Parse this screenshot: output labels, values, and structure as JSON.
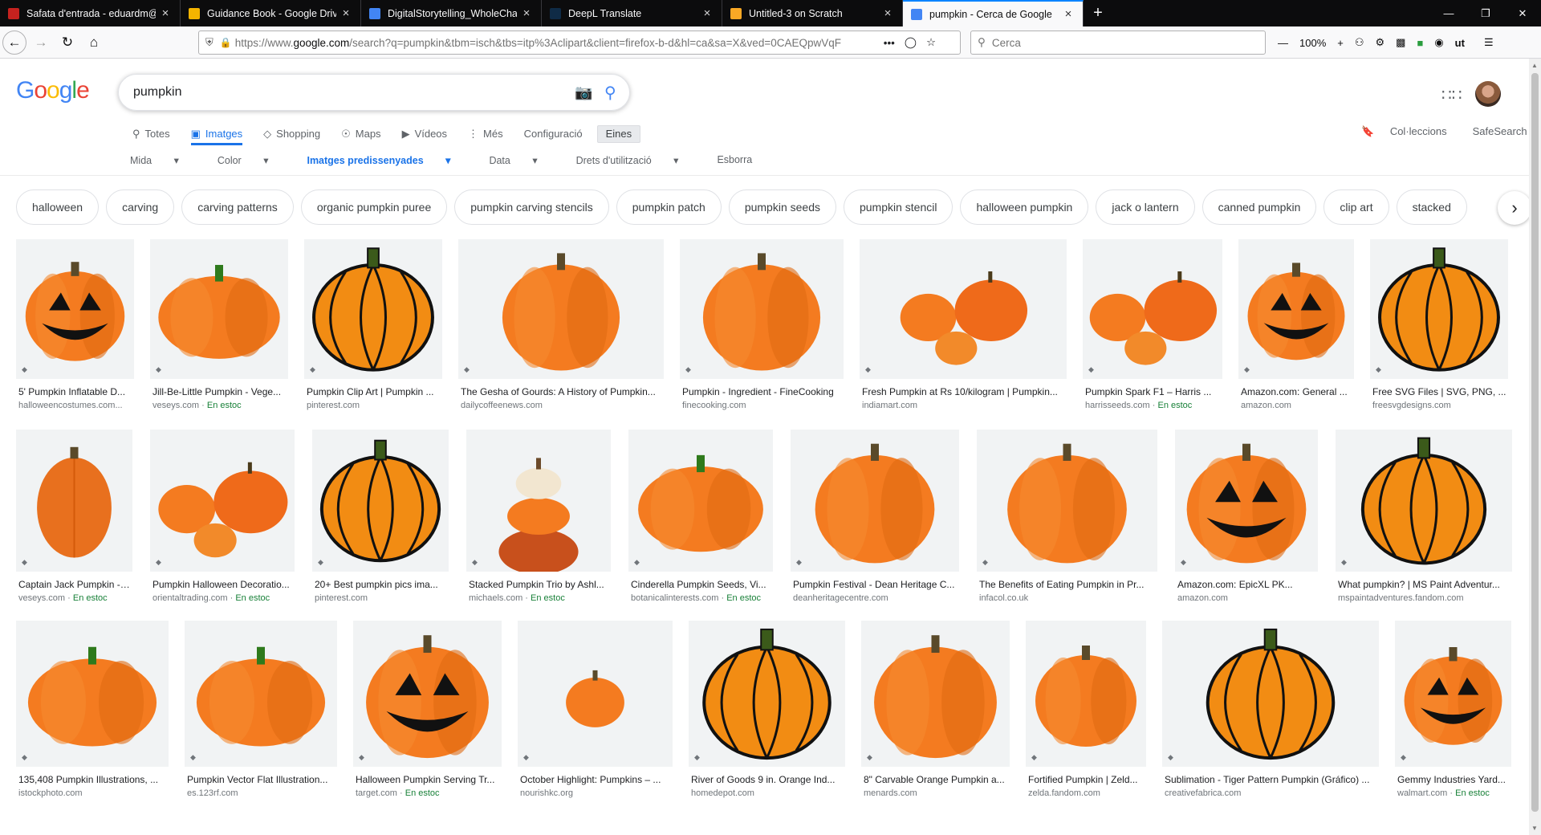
{
  "tabs": [
    {
      "label": "Safata d'entrada - eduardm@g",
      "icon": "gmail-icon",
      "color": "#c5221f"
    },
    {
      "label": "Guidance Book - Google Drive",
      "icon": "drive-icon",
      "color": "#f4b400"
    },
    {
      "label": "DigitalStorytelling_WholeChapt",
      "icon": "docs-icon",
      "color": "#4285f4"
    },
    {
      "label": "DeepL Translate",
      "icon": "deepl-icon",
      "color": "#0f2b46"
    },
    {
      "label": "Untitled-3 on Scratch",
      "icon": "scratch-icon",
      "color": "#f9a825"
    },
    {
      "label": "pumpkin - Cerca de Google",
      "icon": "google-icon",
      "color": "#4285f4",
      "active": true
    }
  ],
  "nav": {
    "url_prefix": "https://www.",
    "url_domain": "google.com",
    "url_rest": "/search?q=pumpkin&tbm=isch&tbs=itp%3Aclipart&client=firefox-b-d&hl=ca&sa=X&ved=0CAEQpwVqF",
    "search_placeholder": "Cerca",
    "zoom": "100%"
  },
  "google": {
    "logo": "Google",
    "query": "pumpkin",
    "tabs": [
      {
        "label": "Totes",
        "icon": "search-icon"
      },
      {
        "label": "Imatges",
        "icon": "image-icon",
        "active": true
      },
      {
        "label": "Shopping",
        "icon": "tag-icon"
      },
      {
        "label": "Maps",
        "icon": "pin-icon"
      },
      {
        "label": "Vídeos",
        "icon": "video-icon"
      },
      {
        "label": "Més",
        "icon": "more-icon"
      }
    ],
    "settings": "Configuració",
    "tools": "Eines",
    "collections": "Col·leccions",
    "safesearch": "SafeSearch",
    "filters": [
      {
        "label": "Mida",
        "dropdown": true
      },
      {
        "label": "Color",
        "dropdown": true
      },
      {
        "label": "Imatges predissenyades",
        "dropdown": true,
        "active": true
      },
      {
        "label": "Data",
        "dropdown": true
      },
      {
        "label": "Drets d'utilització",
        "dropdown": true
      },
      {
        "label": "Esborra",
        "dropdown": false
      }
    ],
    "chips": [
      "halloween",
      "carving",
      "carving patterns",
      "organic pumpkin puree",
      "pumpkin carving stencils",
      "pumpkin patch",
      "pumpkin seeds",
      "pumpkin stencil",
      "halloween pumpkin",
      "jack o lantern",
      "canned pumpkin",
      "clip art",
      "stacked"
    ]
  },
  "results": [
    [
      {
        "title": "5' Pumpkin Inflatable D...",
        "source": "halloweencostumes.com...",
        "stock": "",
        "style": "jack"
      },
      {
        "title": "Jill-Be-Little Pumpkin - Vege...",
        "source": "veseys.com · ",
        "stock": "En estoc",
        "style": "flat"
      },
      {
        "title": "Pumpkin Clip Art | Pumpkin ...",
        "source": "pinterest.com",
        "stock": "",
        "style": "outline"
      },
      {
        "title": "The Gesha of Gourds: A History of Pumpkin...",
        "source": "dailycoffeenews.com",
        "stock": "",
        "style": "round"
      },
      {
        "title": "Pumpkin - Ingredient - FineCooking",
        "source": "finecooking.com",
        "stock": "",
        "style": "round"
      },
      {
        "title": "Fresh Pumpkin at Rs 10/kilogram | Pumpkin...",
        "source": "indiamart.com",
        "stock": "",
        "style": "group"
      },
      {
        "title": "Pumpkin Spark F1 – Harris ...",
        "source": "harrisseeds.com · ",
        "stock": "En estoc",
        "style": "group"
      },
      {
        "title": "Amazon.com: General ...",
        "source": "amazon.com",
        "stock": "",
        "style": "jack"
      },
      {
        "title": "Free SVG Files | SVG, PNG, ...",
        "source": "freesvgdesigns.com",
        "stock": "",
        "style": "outline"
      }
    ],
    [
      {
        "title": "Captain Jack Pumpkin - Vege...",
        "source": "veseys.com · ",
        "stock": "En estoc",
        "style": "tall"
      },
      {
        "title": "Pumpkin Halloween Decoratio...",
        "source": "orientaltrading.com · ",
        "stock": "En estoc",
        "style": "group"
      },
      {
        "title": "20+ Best pumpkin pics ima...",
        "source": "pinterest.com",
        "stock": "",
        "style": "outline"
      },
      {
        "title": "Stacked Pumpkin Trio by Ashl...",
        "source": "michaels.com · ",
        "stock": "En estoc",
        "style": "stack"
      },
      {
        "title": "Cinderella Pumpkin Seeds, Vi...",
        "source": "botanicalinterests.com · ",
        "stock": "En estoc",
        "style": "flat"
      },
      {
        "title": "Pumpkin Festival - Dean Heritage C...",
        "source": "deanheritagecentre.com",
        "stock": "",
        "style": "round"
      },
      {
        "title": "The Benefits of Eating Pumpkin in Pr...",
        "source": "infacol.co.uk",
        "stock": "",
        "style": "round"
      },
      {
        "title": "Amazon.com: EpicXL PK...",
        "source": "amazon.com",
        "stock": "",
        "style": "jack"
      },
      {
        "title": "What pumpkin? | MS Paint Adventur...",
        "source": "mspaintadventures.fandom.com",
        "stock": "",
        "style": "outline"
      }
    ],
    [
      {
        "title": "135,408 Pumpkin Illustrations, ...",
        "source": "istockphoto.com",
        "stock": "",
        "style": "flat"
      },
      {
        "title": "Pumpkin Vector Flat Illustration...",
        "source": "es.123rf.com",
        "stock": "",
        "style": "flat"
      },
      {
        "title": "Halloween Pumpkin Serving Tr...",
        "source": "target.com · ",
        "stock": "En estoc",
        "style": "jack"
      },
      {
        "title": "October Highlight: Pumpkins – ...",
        "source": "nourishkc.org",
        "stock": "",
        "style": "small"
      },
      {
        "title": "River of Goods 9 in. Orange Ind...",
        "source": "homedepot.com",
        "stock": "",
        "style": "outline"
      },
      {
        "title": "8\" Carvable Orange Pumpkin a...",
        "source": "menards.com",
        "stock": "",
        "style": "round"
      },
      {
        "title": "Fortified Pumpkin | Zeld...",
        "source": "zelda.fandom.com",
        "stock": "",
        "style": "round"
      },
      {
        "title": "Sublimation - Tiger Pattern Pumpkin (Gráfico) ...",
        "source": "creativefabrica.com",
        "stock": "",
        "style": "outline"
      },
      {
        "title": "Gemmy Industries Yard...",
        "source": "walmart.com · ",
        "stock": "En estoc",
        "style": "jack"
      }
    ]
  ],
  "colors": {
    "accent": "#1a73e8",
    "stock": "#188038",
    "pumpkin": "#f47b20"
  }
}
